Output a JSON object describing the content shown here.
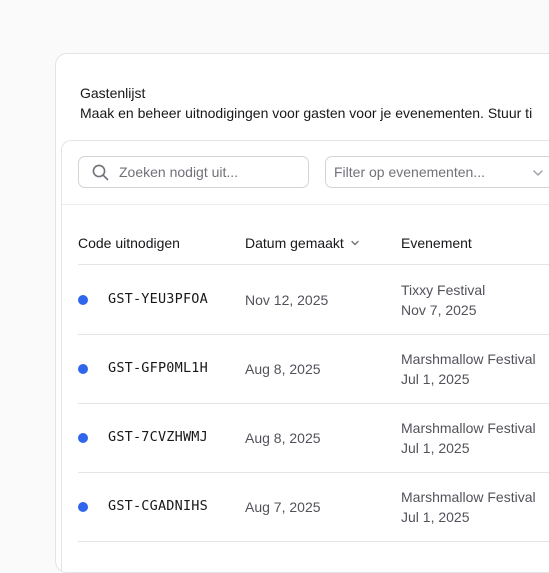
{
  "header": {
    "title": "Gastenlijst",
    "description": "Maak en beheer uitnodigingen voor gasten voor je evenementen. Stuur ti"
  },
  "search": {
    "placeholder": "Zoeken nodigt uit..."
  },
  "filter": {
    "placeholder": "Filter op evenementen..."
  },
  "icons": {
    "search": "search-icon",
    "filter": "chevron-down-icon",
    "sort": "chevron-down-icon",
    "status": "status-dot"
  },
  "colors": {
    "status_dot": "#2f66eb"
  },
  "table": {
    "columns": [
      "Code uitnodigen",
      "Datum gemaakt",
      "Evenement"
    ],
    "rows": [
      {
        "code": "GST-YEU3PFOA",
        "date": "Nov 12, 2025",
        "event": "Tixxy Festival",
        "event_date": "Nov 7, 2025"
      },
      {
        "code": "GST-GFP0ML1H",
        "date": "Aug 8, 2025",
        "event": "Marshmallow Festival",
        "event_date": "Jul 1, 2025"
      },
      {
        "code": "GST-7CVZHWMJ",
        "date": "Aug 8, 2025",
        "event": "Marshmallow Festival",
        "event_date": "Jul 1, 2025"
      },
      {
        "code": "GST-CGADNIHS",
        "date": "Aug 7, 2025",
        "event": "Marshmallow Festival",
        "event_date": "Jul 1, 2025"
      }
    ]
  }
}
